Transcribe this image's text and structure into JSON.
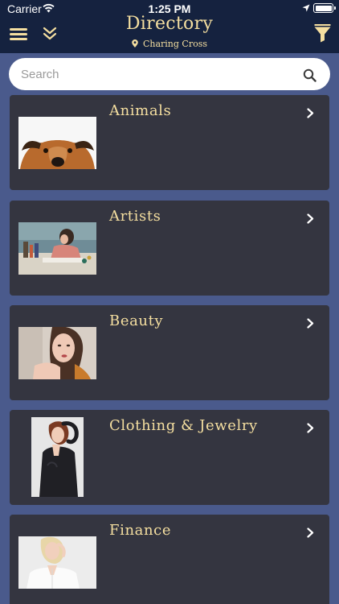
{
  "status_bar": {
    "carrier": "Carrier",
    "time": "1:25 PM"
  },
  "header": {
    "title": "Directory",
    "location": "Charing Cross",
    "icons": [
      "menu-icon",
      "double-chevron-down-icon",
      "location-pin-icon",
      "filter-funnel-icon"
    ]
  },
  "search": {
    "placeholder": "Search",
    "value": ""
  },
  "categories": [
    {
      "label": "Animals",
      "image": "dog-peeking-photo"
    },
    {
      "label": "Artists",
      "image": "woman-painting-photo"
    },
    {
      "label": "Beauty",
      "image": "woman-portrait-photo"
    },
    {
      "label": "Clothing & Jewelry",
      "image": "fashion-model-photo"
    },
    {
      "label": "Finance",
      "image": "businesswoman-photo"
    }
  ],
  "colors": {
    "header_bg": "#15223f",
    "page_bg": "#4a5a8c",
    "card_bg": "#343540",
    "accent_gold": "#f5dfa0"
  }
}
